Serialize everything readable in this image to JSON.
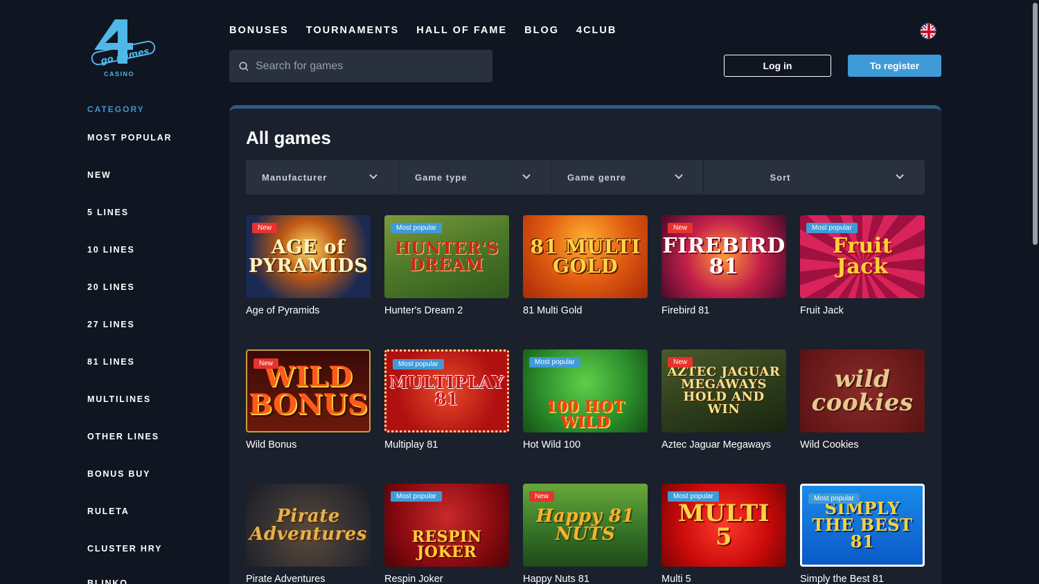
{
  "logo": {
    "mark": "4",
    "brand": "go games",
    "sub": "CASINO"
  },
  "sidebar": {
    "title": "CATEGORY",
    "items": [
      "MOST POPULAR",
      "NEW",
      "5 LINES",
      "10 LINES",
      "20 LINES",
      "27 LINES",
      "81 LINES",
      "MULTILINES",
      "OTHER LINES",
      "BONUS BUY",
      "RULETA",
      "CLUSTER HRY",
      "BLINKO"
    ]
  },
  "nav": {
    "items": [
      "BONUSES",
      "TOURNAMENTS",
      "HALL OF FAME",
      "BLOG",
      "4CLUB"
    ]
  },
  "search": {
    "placeholder": "Search for games",
    "value": ""
  },
  "auth": {
    "login": "Log in",
    "register": "To register"
  },
  "main": {
    "title": "All games",
    "filters": [
      "Manufacturer",
      "Game type",
      "Game genre",
      "Sort"
    ]
  },
  "games": [
    {
      "name": "Age of Pyramids",
      "badge": "New",
      "art": "AGE of PYRAMIDS"
    },
    {
      "name": "Hunter's Dream 2",
      "badge": "Most popular",
      "art": "HUNTER'S DREAM"
    },
    {
      "name": "81 Multi Gold",
      "badge": "",
      "art": "81 MULTI GOLD"
    },
    {
      "name": "Firebird 81",
      "badge": "New",
      "art": "FIREBIRD 81"
    },
    {
      "name": "Fruit Jack",
      "badge": "Most popular",
      "art": "Fruit Jack"
    },
    {
      "name": "Wild Bonus",
      "badge": "New",
      "art": "WILD BONUS"
    },
    {
      "name": "Multiplay 81",
      "badge": "Most popular",
      "art": "MULTIPLAY 81"
    },
    {
      "name": "Hot Wild 100",
      "badge": "Most popular",
      "art": "100 HOT WILD"
    },
    {
      "name": "Aztec Jaguar Megaways",
      "badge": "New",
      "art": "AZTEC JAGUAR MEGAWAYS HOLD AND WIN"
    },
    {
      "name": "Wild Cookies",
      "badge": "",
      "art": "wild cookies"
    },
    {
      "name": "Pirate Adventures",
      "badge": "",
      "art": "Pirate Adventures"
    },
    {
      "name": "Respin Joker",
      "badge": "Most popular",
      "art": "RESPIN JOKER"
    },
    {
      "name": "Happy Nuts 81",
      "badge": "New",
      "art": "Happy 81 NUTS"
    },
    {
      "name": "Multi 5",
      "badge": "Most popular",
      "art": "MULTI 5"
    },
    {
      "name": "Simply the Best 81",
      "badge": "Most popular",
      "art": "SIMPLY THE BEST 81"
    }
  ],
  "colors": {
    "bg": "#0f1521",
    "panel": "#1a202c",
    "accent": "#3f9ad8",
    "new_badge": "#e8322e",
    "category_title": "#3f98cf"
  }
}
